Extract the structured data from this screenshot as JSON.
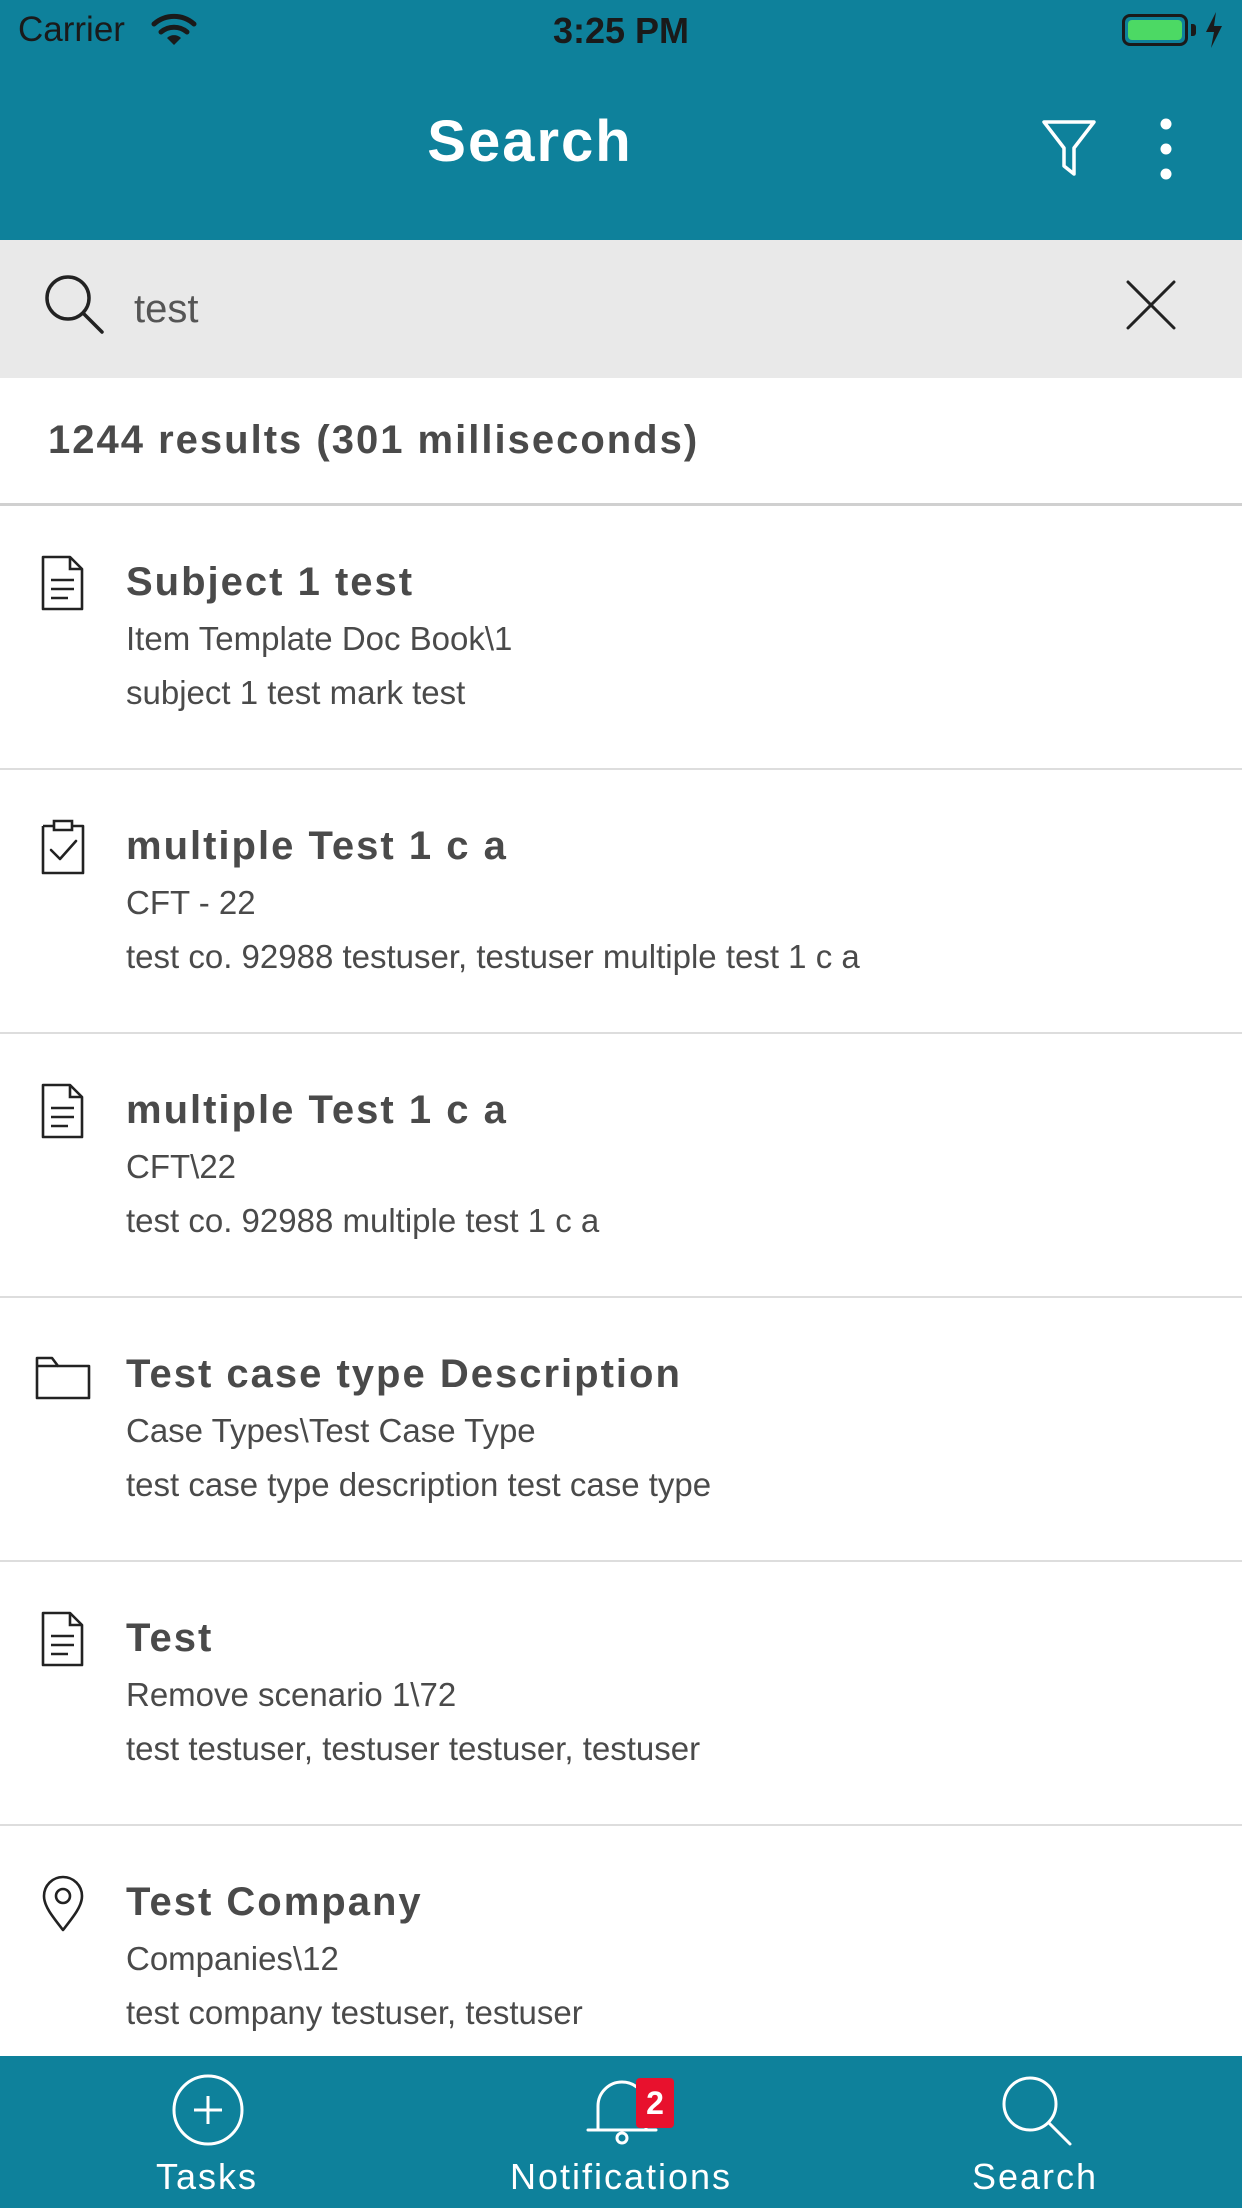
{
  "status_bar": {
    "carrier": "Carrier",
    "time": "3:25 PM",
    "battery_color": "#4cd964"
  },
  "nav": {
    "title": "Search",
    "filter_icon": "filter-icon",
    "more_icon": "more-vertical-icon",
    "background": "#0e819b"
  },
  "search": {
    "value": "test",
    "search_icon": "search-icon",
    "clear_icon": "close-icon"
  },
  "results_summary": "1244 results (301 milliseconds)",
  "results": [
    {
      "icon": "document-icon",
      "title": "Subject 1 test",
      "path": "Item Template Doc Book\\1",
      "snippet": "subject 1 test mark test"
    },
    {
      "icon": "clipboard-check-icon",
      "title": "multiple Test 1 c a",
      "path": "CFT - 22",
      "snippet": "test co. 92988 testuser, testuser multiple test 1 c a"
    },
    {
      "icon": "document-icon",
      "title": "multiple Test 1 c a",
      "path": "CFT\\22",
      "snippet": "test co. 92988 multiple test 1 c a"
    },
    {
      "icon": "folder-icon",
      "title": "Test case type Description",
      "path": "Case Types\\Test Case Type",
      "snippet": "test case type description test case type"
    },
    {
      "icon": "document-icon",
      "title": "Test",
      "path": "Remove scenario 1\\72",
      "snippet": "test testuser, testuser testuser, testuser"
    },
    {
      "icon": "location-pin-icon",
      "title": "Test Company",
      "path": "Companies\\12",
      "snippet": "test company testuser, testuser"
    }
  ],
  "tabbar": {
    "tabs": [
      {
        "label": "Tasks",
        "icon": "plus-circle-icon"
      },
      {
        "label": "Notifications",
        "icon": "bell-icon",
        "badge": "2"
      },
      {
        "label": "Search",
        "icon": "search-icon"
      }
    ],
    "badge_color": "#e8112d"
  }
}
